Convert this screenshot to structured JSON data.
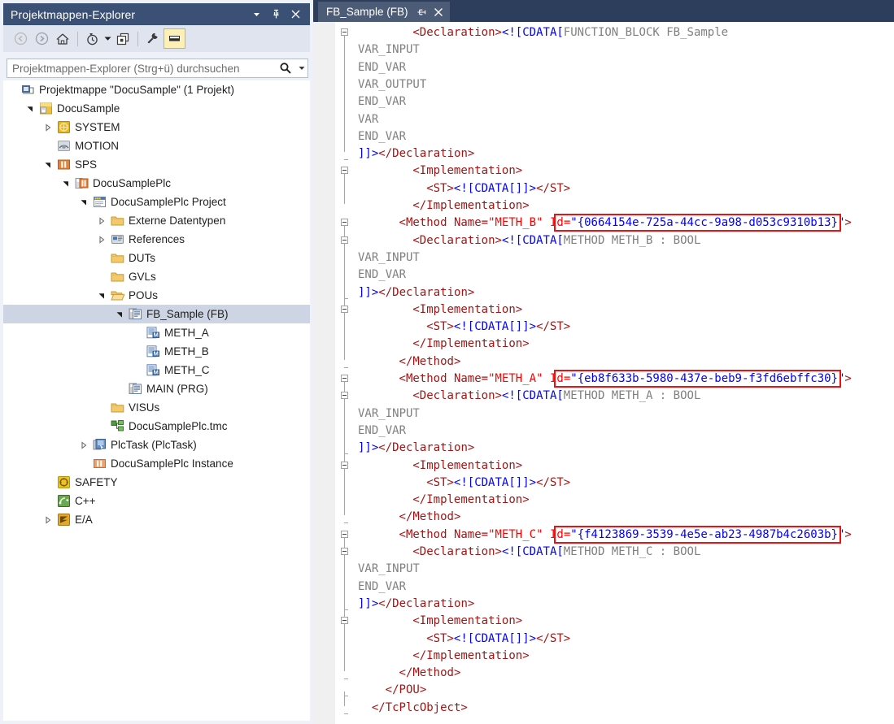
{
  "solution_explorer": {
    "title": "Projektmappen-Explorer",
    "title_buttons": [
      {
        "name": "dropdown",
        "glyph": "▾"
      },
      {
        "name": "pin",
        "glyph": "pin"
      },
      {
        "name": "close",
        "glyph": "✕"
      }
    ],
    "toolbar": [
      {
        "name": "back",
        "label": "Zurück"
      },
      {
        "name": "forward",
        "label": "Vorwärts"
      },
      {
        "name": "home",
        "label": "Startseite"
      },
      {
        "name": "pending-changes",
        "label": "Ausstehende Änderungen"
      },
      {
        "name": "pending-changes-dropdown",
        "label": "▾"
      },
      {
        "name": "show-all-files",
        "label": "Alle Dateien anzeigen"
      },
      {
        "name": "properties",
        "label": "Eigenschaften"
      },
      {
        "name": "preview-selected-items",
        "label": "Vorschau ausgewählter Elemente"
      }
    ],
    "search": {
      "placeholder": "Projektmappen-Explorer (Strg+ü) durchsuchen",
      "icon": "search-icon",
      "dropdown": "▾"
    },
    "tree": [
      {
        "label": "Projektmappe \"DocuSample\" (1 Projekt)",
        "depth": 0,
        "expander": "none",
        "icon": "solution-icon",
        "selected": false
      },
      {
        "label": "DocuSample",
        "depth": 1,
        "expander": "expanded",
        "icon": "project-icon",
        "selected": false
      },
      {
        "label": "SYSTEM",
        "depth": 2,
        "expander": "collapsed",
        "icon": "system-icon",
        "selected": false
      },
      {
        "label": "MOTION",
        "depth": 2,
        "expander": "none",
        "icon": "motion-icon",
        "selected": false
      },
      {
        "label": "SPS",
        "depth": 2,
        "expander": "expanded",
        "icon": "plc-icon",
        "selected": false
      },
      {
        "label": "DocuSamplePlc",
        "depth": 3,
        "expander": "expanded",
        "icon": "plc-project-icon",
        "selected": false
      },
      {
        "label": "DocuSamplePlc Project",
        "depth": 4,
        "expander": "expanded",
        "icon": "plc-proj-file-icon",
        "selected": false
      },
      {
        "label": "Externe Datentypen",
        "depth": 5,
        "expander": "collapsed",
        "icon": "folder-icon",
        "selected": false
      },
      {
        "label": "References",
        "depth": 5,
        "expander": "collapsed",
        "icon": "references-icon",
        "selected": false
      },
      {
        "label": "DUTs",
        "depth": 5,
        "expander": "none",
        "icon": "folder-icon",
        "selected": false
      },
      {
        "label": "GVLs",
        "depth": 5,
        "expander": "none",
        "icon": "folder-icon",
        "selected": false
      },
      {
        "label": "POUs",
        "depth": 5,
        "expander": "expanded",
        "icon": "folder-open-icon",
        "selected": false
      },
      {
        "label": "FB_Sample (FB)",
        "depth": 6,
        "expander": "expanded",
        "icon": "fb-icon",
        "selected": true
      },
      {
        "label": "METH_A",
        "depth": 7,
        "expander": "none",
        "icon": "method-icon",
        "selected": false
      },
      {
        "label": "METH_B",
        "depth": 7,
        "expander": "none",
        "icon": "method-icon",
        "selected": false
      },
      {
        "label": "METH_C",
        "depth": 7,
        "expander": "none",
        "icon": "method-icon",
        "selected": false
      },
      {
        "label": "MAIN (PRG)",
        "depth": 6,
        "expander": "none",
        "icon": "prg-icon",
        "selected": false
      },
      {
        "label": "VISUs",
        "depth": 5,
        "expander": "none",
        "icon": "folder-icon",
        "selected": false
      },
      {
        "label": "DocuSamplePlc.tmc",
        "depth": 5,
        "expander": "none",
        "icon": "tmc-icon",
        "selected": false
      },
      {
        "label": "PlcTask (PlcTask)",
        "depth": 4,
        "expander": "collapsed",
        "icon": "task-icon",
        "selected": false
      },
      {
        "label": "DocuSamplePlc Instance",
        "depth": 4,
        "expander": "none",
        "icon": "instance-icon",
        "selected": false
      },
      {
        "label": "SAFETY",
        "depth": 2,
        "expander": "none",
        "icon": "safety-icon",
        "selected": false
      },
      {
        "label": "C++",
        "depth": 2,
        "expander": "none",
        "icon": "cpp-icon",
        "selected": false
      },
      {
        "label": "E/A",
        "depth": 2,
        "expander": "collapsed",
        "icon": "io-icon",
        "selected": false
      }
    ]
  },
  "editor": {
    "tab": {
      "label": "FB_Sample (FB)",
      "pin_icon": "pin-icon",
      "close_icon": "close-icon"
    },
    "colors": {
      "xml_tag": "#a31515",
      "xml_bracket": "#0000ff",
      "xml_attr_name": "#ff0000",
      "xml_attr_value": "#0000ff",
      "cdata_text": "#808080",
      "highlight_box": "#ee1111",
      "tab_active_bg": "#4c5c77",
      "panel_title_bg": "#3a5074",
      "window_bg": "#2d3e5c",
      "tree_selection_bg": "#cdd5e4"
    },
    "lines": [
      {
        "indent": 8,
        "segments": [
          {
            "t": "<Declaration>",
            "c": "tag"
          },
          {
            "t": "<![CDATA[",
            "c": "br"
          },
          {
            "t": "FUNCTION_BLOCK FB_Sample",
            "c": "cdata"
          }
        ]
      },
      {
        "indent": 0,
        "segments": [
          {
            "t": "VAR_INPUT",
            "c": "cdata"
          }
        ]
      },
      {
        "indent": 0,
        "segments": [
          {
            "t": "END_VAR",
            "c": "cdata"
          }
        ]
      },
      {
        "indent": 0,
        "segments": [
          {
            "t": "VAR_OUTPUT",
            "c": "cdata"
          }
        ]
      },
      {
        "indent": 0,
        "segments": [
          {
            "t": "END_VAR",
            "c": "cdata"
          }
        ]
      },
      {
        "indent": 0,
        "segments": [
          {
            "t": "VAR",
            "c": "cdata"
          }
        ]
      },
      {
        "indent": 0,
        "segments": [
          {
            "t": "END_VAR",
            "c": "cdata"
          }
        ]
      },
      {
        "indent": 0,
        "segments": [
          {
            "t": "]]>",
            "c": "br"
          },
          {
            "t": "</Declaration>",
            "c": "tag"
          }
        ]
      },
      {
        "indent": 8,
        "segments": [
          {
            "t": "<Implementation>",
            "c": "tag"
          }
        ]
      },
      {
        "indent": 10,
        "segments": [
          {
            "t": "<ST>",
            "c": "tag"
          },
          {
            "t": "<![CDATA[]]>",
            "c": "br"
          },
          {
            "t": "</ST>",
            "c": "tag"
          }
        ]
      },
      {
        "indent": 8,
        "segments": [
          {
            "t": "</Implementation>",
            "c": "tag"
          }
        ]
      },
      {
        "indent": 6,
        "segments": [
          {
            "t": "<Method Name=",
            "c": "tag"
          },
          {
            "t": "\"METH_B\"",
            "c": "attr"
          },
          {
            "t": " ",
            "c": "tag"
          },
          {
            "t": "Id=",
            "c": "attr"
          },
          {
            "t": "\"{0664154e-725a-44cc-9a98-d053c9310b13}\"",
            "c": "val"
          },
          {
            "t": ">",
            "c": "tag"
          }
        ],
        "highlight": {
          "from_char": 23,
          "to_char": 64
        }
      },
      {
        "indent": 8,
        "segments": [
          {
            "t": "<Declaration>",
            "c": "tag"
          },
          {
            "t": "<![CDATA[",
            "c": "br"
          },
          {
            "t": "METHOD METH_B : BOOL",
            "c": "cdata"
          }
        ]
      },
      {
        "indent": 0,
        "segments": [
          {
            "t": "VAR_INPUT",
            "c": "cdata"
          }
        ]
      },
      {
        "indent": 0,
        "segments": [
          {
            "t": "END_VAR",
            "c": "cdata"
          }
        ]
      },
      {
        "indent": 0,
        "segments": [
          {
            "t": "]]>",
            "c": "br"
          },
          {
            "t": "</Declaration>",
            "c": "tag"
          }
        ]
      },
      {
        "indent": 8,
        "segments": [
          {
            "t": "<Implementation>",
            "c": "tag"
          }
        ]
      },
      {
        "indent": 10,
        "segments": [
          {
            "t": "<ST>",
            "c": "tag"
          },
          {
            "t": "<![CDATA[]]>",
            "c": "br"
          },
          {
            "t": "</ST>",
            "c": "tag"
          }
        ]
      },
      {
        "indent": 8,
        "segments": [
          {
            "t": "</Implementation>",
            "c": "tag"
          }
        ]
      },
      {
        "indent": 6,
        "segments": [
          {
            "t": "</Method>",
            "c": "tag"
          }
        ]
      },
      {
        "indent": 6,
        "segments": [
          {
            "t": "<Method Name=",
            "c": "tag"
          },
          {
            "t": "\"METH_A\"",
            "c": "attr"
          },
          {
            "t": " ",
            "c": "tag"
          },
          {
            "t": "Id=",
            "c": "attr"
          },
          {
            "t": "\"{eb8f633b-5980-437e-beb9-f3fd6ebffc30}\"",
            "c": "val"
          },
          {
            "t": ">",
            "c": "tag"
          }
        ],
        "highlight": {
          "from_char": 23,
          "to_char": 64
        }
      },
      {
        "indent": 8,
        "segments": [
          {
            "t": "<Declaration>",
            "c": "tag"
          },
          {
            "t": "<![CDATA[",
            "c": "br"
          },
          {
            "t": "METHOD METH_A : BOOL",
            "c": "cdata"
          }
        ]
      },
      {
        "indent": 0,
        "segments": [
          {
            "t": "VAR_INPUT",
            "c": "cdata"
          }
        ]
      },
      {
        "indent": 0,
        "segments": [
          {
            "t": "END_VAR",
            "c": "cdata"
          }
        ]
      },
      {
        "indent": 0,
        "segments": [
          {
            "t": "]]>",
            "c": "br"
          },
          {
            "t": "</Declaration>",
            "c": "tag"
          }
        ]
      },
      {
        "indent": 8,
        "segments": [
          {
            "t": "<Implementation>",
            "c": "tag"
          }
        ]
      },
      {
        "indent": 10,
        "segments": [
          {
            "t": "<ST>",
            "c": "tag"
          },
          {
            "t": "<![CDATA[]]>",
            "c": "br"
          },
          {
            "t": "</ST>",
            "c": "tag"
          }
        ]
      },
      {
        "indent": 8,
        "segments": [
          {
            "t": "</Implementation>",
            "c": "tag"
          }
        ]
      },
      {
        "indent": 6,
        "segments": [
          {
            "t": "</Method>",
            "c": "tag"
          }
        ]
      },
      {
        "indent": 6,
        "segments": [
          {
            "t": "<Method Name=",
            "c": "tag"
          },
          {
            "t": "\"METH_C\"",
            "c": "attr"
          },
          {
            "t": " ",
            "c": "tag"
          },
          {
            "t": "Id=",
            "c": "attr"
          },
          {
            "t": "\"{f4123869-3539-4e5e-ab23-4987b4c2603b}\"",
            "c": "val"
          },
          {
            "t": ">",
            "c": "tag"
          }
        ],
        "highlight": {
          "from_char": 23,
          "to_char": 64
        }
      },
      {
        "indent": 8,
        "segments": [
          {
            "t": "<Declaration>",
            "c": "tag"
          },
          {
            "t": "<![CDATA[",
            "c": "br"
          },
          {
            "t": "METHOD METH_C : BOOL",
            "c": "cdata"
          }
        ]
      },
      {
        "indent": 0,
        "segments": [
          {
            "t": "VAR_INPUT",
            "c": "cdata"
          }
        ]
      },
      {
        "indent": 0,
        "segments": [
          {
            "t": "END_VAR",
            "c": "cdata"
          }
        ]
      },
      {
        "indent": 0,
        "segments": [
          {
            "t": "]]>",
            "c": "br"
          },
          {
            "t": "</Declaration>",
            "c": "tag"
          }
        ]
      },
      {
        "indent": 8,
        "segments": [
          {
            "t": "<Implementation>",
            "c": "tag"
          }
        ]
      },
      {
        "indent": 10,
        "segments": [
          {
            "t": "<ST>",
            "c": "tag"
          },
          {
            "t": "<![CDATA[]]>",
            "c": "br"
          },
          {
            "t": "</ST>",
            "c": "tag"
          }
        ]
      },
      {
        "indent": 8,
        "segments": [
          {
            "t": "</Implementation>",
            "c": "tag"
          }
        ]
      },
      {
        "indent": 6,
        "segments": [
          {
            "t": "</Method>",
            "c": "tag"
          }
        ]
      },
      {
        "indent": 4,
        "segments": [
          {
            "t": "</POU>",
            "c": "tag"
          }
        ]
      },
      {
        "indent": 2,
        "segments": [
          {
            "t": "</TcPlcObject>",
            "c": "tag"
          }
        ]
      }
    ],
    "fold_markers": [
      0,
      8,
      11,
      12,
      16,
      20,
      21,
      25,
      29,
      30,
      34
    ],
    "fold_ticks": [
      7,
      15,
      19,
      24,
      28,
      33,
      37,
      38,
      39
    ],
    "fold_guides": [
      {
        "from": 0,
        "to": 7
      },
      {
        "from": 8,
        "to": 10
      },
      {
        "from": 11,
        "to": 19
      },
      {
        "from": 12,
        "to": 15
      },
      {
        "from": 16,
        "to": 18
      },
      {
        "from": 20,
        "to": 28
      },
      {
        "from": 21,
        "to": 24
      },
      {
        "from": 25,
        "to": 27
      },
      {
        "from": 29,
        "to": 37
      },
      {
        "from": 30,
        "to": 33
      },
      {
        "from": 34,
        "to": 36
      },
      {
        "from": 38,
        "to": 39
      }
    ]
  }
}
